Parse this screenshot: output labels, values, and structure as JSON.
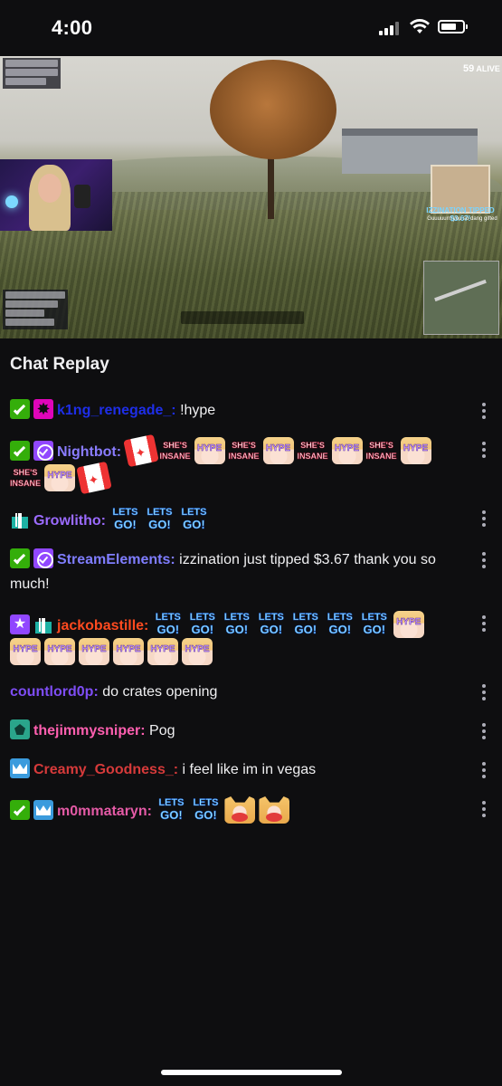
{
  "status_bar": {
    "time": "4:00"
  },
  "video": {
    "hud": {
      "alive_count": "59",
      "alive_label": "ALIVE",
      "tip_alert": "IZZINATION TIPPED $3.67!",
      "tip_message": "Guuuuurrl you so dang gifted"
    }
  },
  "chat": {
    "header": "Chat Replay",
    "messages": [
      {
        "badges": [
          "moderator",
          "vip"
        ],
        "username": "k1ng_renegade_",
        "color": "#1e2ee8",
        "text": "!hype",
        "emotes": []
      },
      {
        "badges": [
          "moderator",
          "verified"
        ],
        "username": "Nightbot",
        "color": "#8a7cff",
        "text": "",
        "emotes": [
          "canada-socks",
          "shes-insane",
          "hype",
          "shes-insane",
          "hype",
          "shes-insane",
          "hype",
          "shes-insane",
          "hype",
          "shes-insane",
          "hype",
          "canada-socks"
        ]
      },
      {
        "badges": [
          "sub-gifter"
        ],
        "username": "Growlitho",
        "color": "#9b6bff",
        "text": "",
        "emotes": [
          "lets-go",
          "lets-go",
          "lets-go"
        ]
      },
      {
        "badges": [
          "moderator",
          "verified"
        ],
        "username": "StreamElements",
        "color": "#7f7dff",
        "text": "izzination just tipped $3.67 thank you so much!",
        "emotes": []
      },
      {
        "badges": [
          "founder",
          "sub-gifter"
        ],
        "username": "jackobastille",
        "color": "#ff4a1f",
        "text": "",
        "emotes": [
          "lets-go",
          "lets-go",
          "lets-go",
          "lets-go",
          "lets-go",
          "lets-go",
          "lets-go",
          "hype",
          "hype",
          "hype",
          "hype",
          "hype",
          "hype",
          "hype"
        ]
      },
      {
        "badges": [],
        "username": "countlord0p",
        "color": "#7e4df5",
        "text": "do crates opening",
        "emotes": []
      },
      {
        "badges": [
          "gem"
        ],
        "username": "thejimmysniper",
        "color": "#ff5fb0",
        "text": "Pog",
        "emotes": []
      },
      {
        "badges": [
          "subscriber"
        ],
        "username": "Creamy_Goodness_",
        "color": "#d63a3a",
        "text": "i feel like im in vegas",
        "emotes": []
      },
      {
        "badges": [
          "moderator",
          "subscriber"
        ],
        "username": "m0mmataryn",
        "color": "#e45aa6",
        "text": "",
        "emotes": [
          "lets-go",
          "lets-go",
          "cat-heart",
          "cat-heart"
        ]
      }
    ]
  }
}
